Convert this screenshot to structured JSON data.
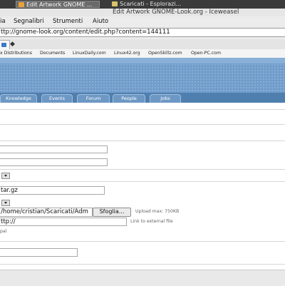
{
  "taskbar": {
    "active_task": "Edit Artwork GNOME ...",
    "inactive_task": "Scaricati - Esplorazi..."
  },
  "window": {
    "title": "Edit Artwork GNOME-Look.org - Iceweasel"
  },
  "menubar": {
    "items": [
      "ia",
      "Segnalibri",
      "Strumenti",
      "Aiuto"
    ]
  },
  "address": {
    "url": "ttp://gnome-look.org/content/edit.php?content=144111"
  },
  "bookmarks": [
    "x Distributions",
    "Documents",
    "LinuxDaily.com",
    "Linux42.org",
    "OpenSkillz.com",
    "Open-PC.com"
  ],
  "nav": {
    "tabs": [
      "Knowledge",
      "Events",
      "Forum",
      "People",
      "Jobs"
    ]
  },
  "form": {
    "field1": "",
    "field2": "",
    "file_name": "tar.gz",
    "upload_path": "/home/cristian/Scaricati/Adm",
    "browse_label": "Sfoglia...",
    "upload_hint": "Upload max: 750KB",
    "external_link": "ttp://",
    "external_hint": "Link to external file",
    "pal_text": "pal",
    "bottom_field": ""
  }
}
